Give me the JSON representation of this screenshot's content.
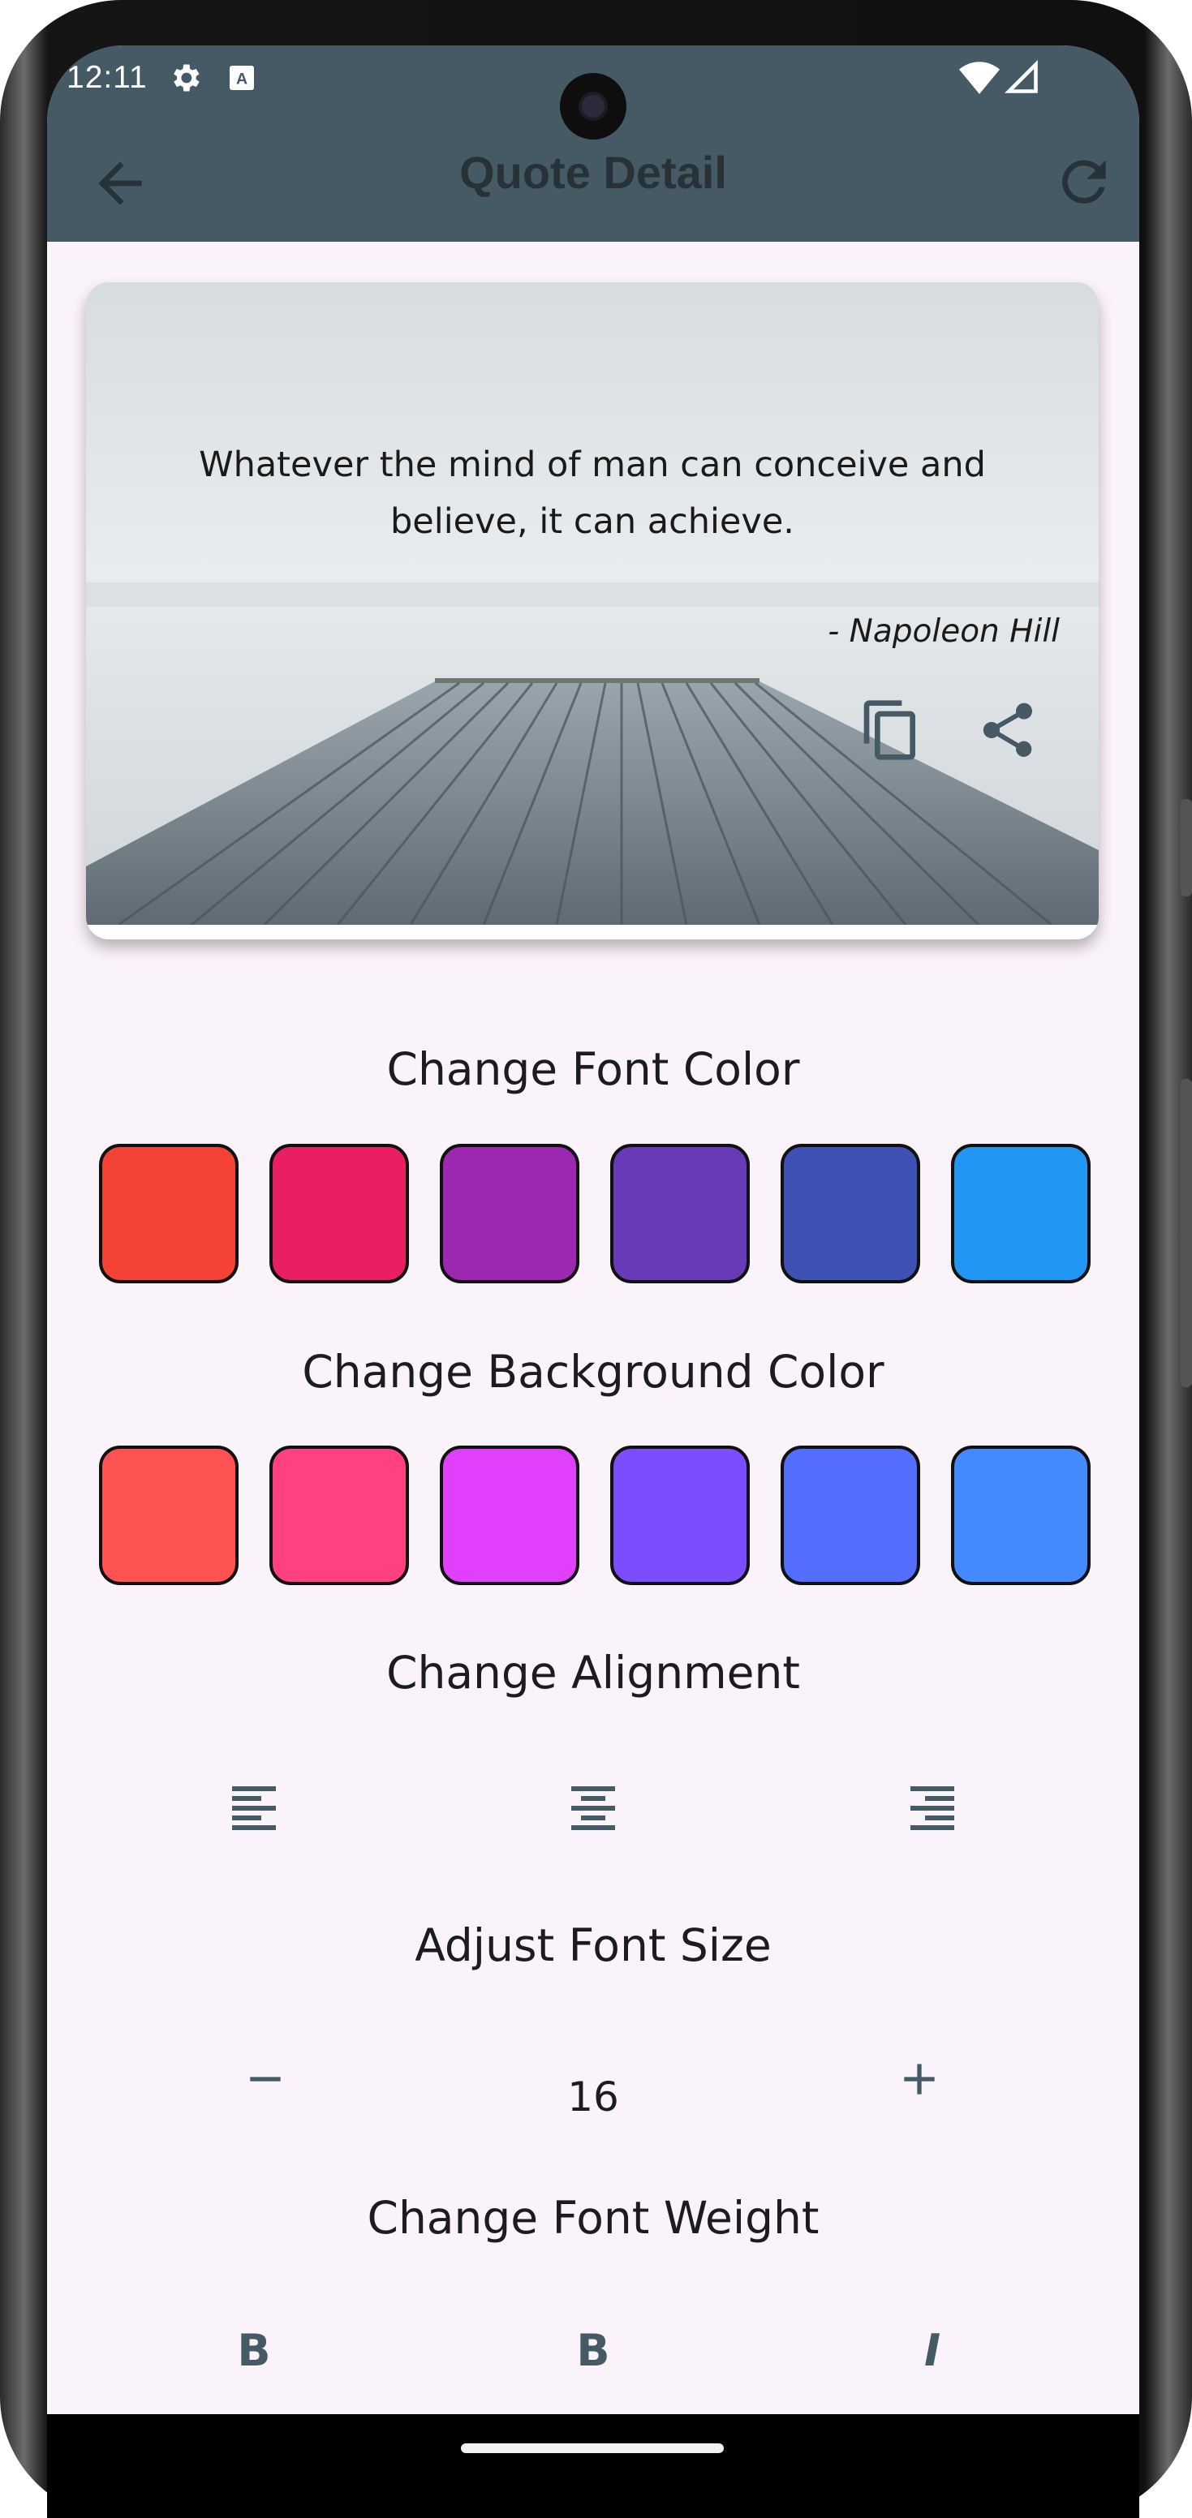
{
  "status_bar": {
    "time": "12:11",
    "icons": [
      "gear-icon",
      "keyboard-a-icon",
      "wifi-icon",
      "signal-icon"
    ]
  },
  "app_bar": {
    "title": "Quote Detail",
    "back_icon": "arrow-back-icon",
    "refresh_icon": "refresh-icon",
    "color": "#455a64"
  },
  "quote_card": {
    "text": "Whatever the mind of man can conceive and believe, it can achieve.",
    "author": "- Napoleon Hill",
    "background": "foggy-pier-photo",
    "actions": [
      "copy-icon",
      "share-icon"
    ]
  },
  "font_color": {
    "title": "Change Font Color",
    "swatches": [
      "#f44336",
      "#e91e63",
      "#9c27b0",
      "#673ab7",
      "#3f51b5",
      "#2196f3"
    ]
  },
  "background_color": {
    "title": "Change Background Color",
    "swatches": [
      "#ff5252",
      "#ff4081",
      "#e040fb",
      "#7c4dff",
      "#536dfe",
      "#448aff"
    ]
  },
  "alignment": {
    "title": "Change Alignment",
    "options": [
      "align-left-icon",
      "align-center-icon",
      "align-right-icon"
    ]
  },
  "font_size": {
    "title": "Adjust Font Size",
    "value": "16",
    "decrease_icon": "minus-icon",
    "increase_icon": "plus-icon"
  },
  "font_weight": {
    "title": "Change Font Weight",
    "options": [
      {
        "icon": "bold-icon",
        "glyph": "B"
      },
      {
        "icon": "bold-icon",
        "glyph": "B"
      },
      {
        "icon": "italic-icon",
        "glyph": "I"
      }
    ]
  }
}
